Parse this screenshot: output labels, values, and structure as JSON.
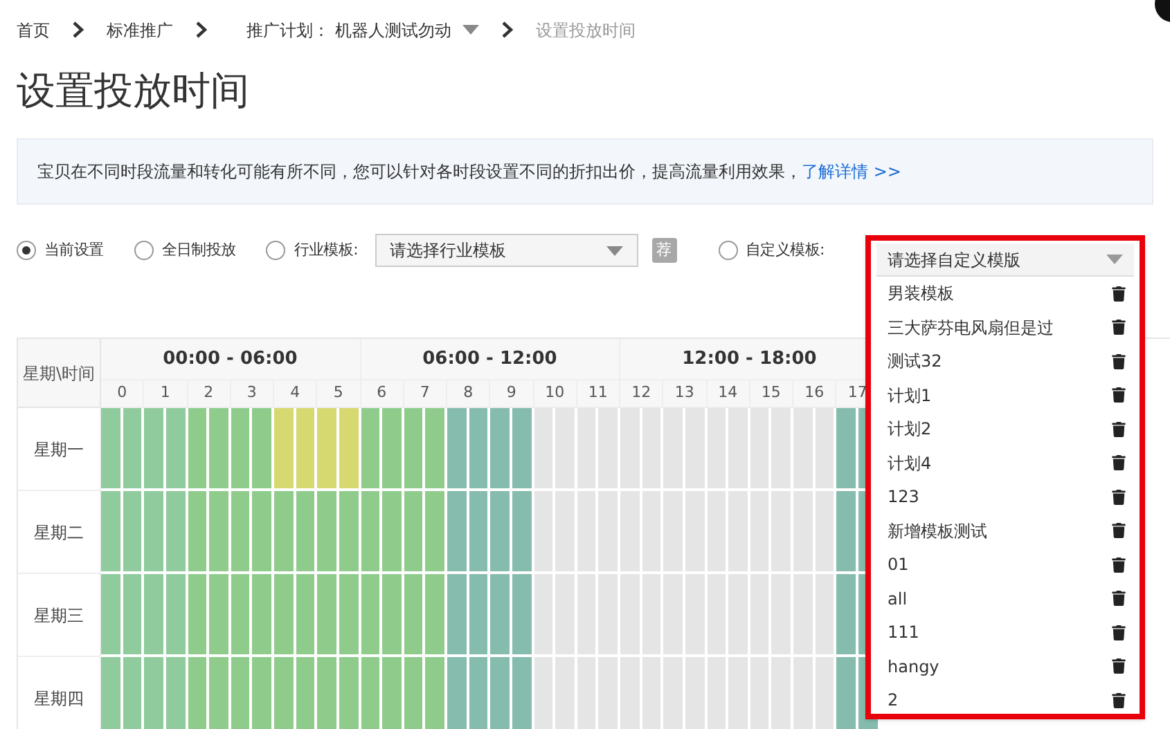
{
  "breadcrumb": [
    {
      "text": "首页",
      "kind": "link"
    },
    {
      "text": "标准推广",
      "kind": "link"
    },
    {
      "text": "推广计划：  机器人测试勿动",
      "kind": "menu"
    },
    {
      "text": "设置投放时间",
      "kind": "current"
    }
  ],
  "title": "设置投放时间",
  "notice": {
    "text": "宝贝在不同时段流量和转化可能有所不同，您可以针对各时段设置不同的折扣出价，提高流量利用效果，",
    "link": "了解详情 >>"
  },
  "options": [
    {
      "label": "当前设置",
      "selected": true
    },
    {
      "label": "全日制投放",
      "selected": false
    },
    {
      "label": "行业模板:",
      "selected": false,
      "placeholder": "请选择行业模板",
      "badge": "荐"
    },
    {
      "label": "自定义模板:",
      "selected": false,
      "placeholder": "请选择自定义模版"
    }
  ],
  "custom_templates": [
    "男装模板",
    "三大萨芬电风扇但是过",
    "测试32",
    "计划1",
    "计划2",
    "计划4",
    "123",
    "新增模板测试",
    "01",
    "all",
    "111",
    "hangy",
    "2"
  ],
  "schedule": {
    "corner": "星期\\时间",
    "groups": [
      "00:00 - 06:00",
      "06:00 - 12:00",
      "12:00 - 18:00"
    ],
    "hours": [
      "0",
      "1",
      "2",
      "3",
      "4",
      "5",
      "6",
      "7",
      "8",
      "9",
      "10",
      "11",
      "12",
      "13",
      "14",
      "15",
      "16",
      "17"
    ],
    "rows": [
      {
        "day": "星期一",
        "cells": [
          {
            "color": "#8fcb9d"
          },
          {
            "color": "#8fcb9d"
          },
          {
            "color": "#8fcc8c"
          },
          {
            "color": "#8fcc8c"
          },
          {
            "color": "#d6d870"
          },
          {
            "color": "#d6d870"
          },
          {
            "color": "#8fcc8c"
          },
          {
            "color": "#8fcc8c"
          },
          {
            "color": "#85bcad"
          },
          {
            "color": "#85bcad"
          },
          {
            "color": "#e5e5e5"
          },
          {
            "color": "#e5e5e5"
          },
          {
            "color": "#e5e5e5"
          },
          {
            "color": "#e5e5e5"
          },
          {
            "color": "#e5e5e5"
          },
          {
            "color": "#e5e5e5"
          },
          {
            "color": "#e5e5e5"
          },
          {
            "color": "#85bcad"
          }
        ]
      },
      {
        "day": "星期二",
        "cells": [
          {
            "color": "#8fcb9d"
          },
          {
            "color": "#8fcb9d"
          },
          {
            "color": "#8fcc8c"
          },
          {
            "color": "#8fcc8c"
          },
          {
            "color": "#8fcc8c"
          },
          {
            "color": "#8fcc8c"
          },
          {
            "color": "#8fcc8c"
          },
          {
            "color": "#8fcc8c"
          },
          {
            "color": "#85bcad"
          },
          {
            "color": "#85bcad"
          },
          {
            "color": "#e5e5e5"
          },
          {
            "color": "#e5e5e5"
          },
          {
            "color": "#e5e5e5"
          },
          {
            "color": "#e5e5e5"
          },
          {
            "color": "#e5e5e5"
          },
          {
            "color": "#e5e5e5"
          },
          {
            "color": "#e5e5e5"
          },
          {
            "color": "#85bcad"
          }
        ]
      },
      {
        "day": "星期三",
        "cells": [
          {
            "color": "#8fcb9d"
          },
          {
            "color": "#8fcb9d"
          },
          {
            "color": "#8fcc8c"
          },
          {
            "color": "#8fcc8c"
          },
          {
            "color": "#8fcc8c"
          },
          {
            "color": "#8fcc8c"
          },
          {
            "color": "#8fcc8c"
          },
          {
            "color": "#8fcc8c"
          },
          {
            "color": "#85bcad"
          },
          {
            "color": "#85bcad"
          },
          {
            "color": "#e5e5e5"
          },
          {
            "color": "#e5e5e5"
          },
          {
            "color": "#e5e5e5"
          },
          {
            "color": "#e5e5e5"
          },
          {
            "color": "#e5e5e5"
          },
          {
            "color": "#e5e5e5"
          },
          {
            "color": "#e5e5e5"
          },
          {
            "color": "#85bcad"
          }
        ]
      },
      {
        "day": "星期四",
        "cells": [
          {
            "color": "#8fcb9d"
          },
          {
            "color": "#8fcb9d"
          },
          {
            "color": "#8fcc8c"
          },
          {
            "color": "#8fcc8c"
          },
          {
            "color": "#8fcc8c"
          },
          {
            "color": "#8fcc8c"
          },
          {
            "color": "#8fcc8c"
          },
          {
            "color": "#8fcc8c"
          },
          {
            "color": "#85bcad"
          },
          {
            "color": "#85bcad"
          },
          {
            "color": "#e5e5e5"
          },
          {
            "color": "#e5e5e5"
          },
          {
            "color": "#e5e5e5"
          },
          {
            "color": "#e5e5e5"
          },
          {
            "color": "#e5e5e5"
          },
          {
            "color": "#e5e5e5"
          },
          {
            "color": "#e5e5e5"
          },
          {
            "color": "#85bcad"
          }
        ]
      }
    ]
  }
}
